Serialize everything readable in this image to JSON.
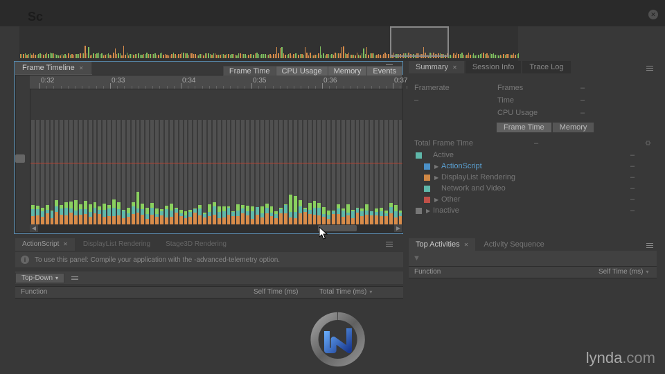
{
  "top": {
    "sc": "Sc"
  },
  "timeline": {
    "tab_label": "Frame Timeline",
    "toolbar": {
      "frame_time": "Frame Time",
      "cpu_usage": "CPU Usage",
      "memory": "Memory",
      "events": "Events"
    },
    "ruler_ticks": [
      "0:32",
      "0:33",
      "0:34",
      "0:35",
      "0:36",
      "0:37"
    ],
    "chart_label": "Frame Time"
  },
  "chart_data": {
    "type": "bar",
    "series_names": [
      "ActionScript",
      "DisplayList Rendering",
      "Network and Video",
      "Other"
    ],
    "approximate_frame_count": 78,
    "budget_line_ms": 16.7,
    "note": "stacked frame-time bars read against unlabeled ms axis; red line = frame budget"
  },
  "summary": {
    "tabs": {
      "summary": "Summary",
      "session_info": "Session Info",
      "trace_log": "Trace Log"
    },
    "framerate": {
      "label": "Framerate",
      "value": "–"
    },
    "frames": {
      "label": "Frames",
      "value": "–"
    },
    "time": {
      "label": "Time",
      "value": "–"
    },
    "cpu_usage": {
      "label": "CPU Usage",
      "value": "–"
    },
    "buttons": {
      "frame_time": "Frame Time",
      "memory": "Memory"
    },
    "total_frame_time": {
      "label": "Total Frame Time",
      "value": "–"
    },
    "legend": [
      {
        "label": "Active",
        "value": "–",
        "color": "#5fb8aa",
        "expandable": false,
        "indent": 0
      },
      {
        "label": "ActionScript",
        "value": "–",
        "color": "#4b90c7",
        "expandable": true,
        "indent": 1,
        "link": true
      },
      {
        "label": "DisplayList Rendering",
        "value": "–",
        "color": "#d08845",
        "expandable": true,
        "indent": 1
      },
      {
        "label": "Network and Video",
        "value": "–",
        "color": "#5fb8aa",
        "expandable": false,
        "indent": 1
      },
      {
        "label": "Other",
        "value": "–",
        "color": "#c05048",
        "expandable": true,
        "indent": 1
      },
      {
        "label": "Inactive",
        "value": "–",
        "color": "#777777",
        "expandable": true,
        "indent": 0
      }
    ]
  },
  "bottom": {
    "tabs": {
      "actionscript": "ActionScript",
      "displaylist": "DisplayList Rendering",
      "stage3d": "Stage3D Rendering"
    },
    "info_message": "To use this panel: Compile your application with the -advanced-telemetry option.",
    "dropdown": "Top-Down",
    "columns": {
      "function": "Function",
      "self_time": "Self Time (ms)",
      "total_time": "Total Time (ms)"
    }
  },
  "activity": {
    "tabs": {
      "top_activities": "Top Activities",
      "activity_sequence": "Activity Sequence"
    },
    "columns": {
      "function": "Function",
      "self_time": "Self Time (ms)"
    }
  },
  "watermark": {
    "brand": "lynda",
    "suffix": ".com"
  }
}
